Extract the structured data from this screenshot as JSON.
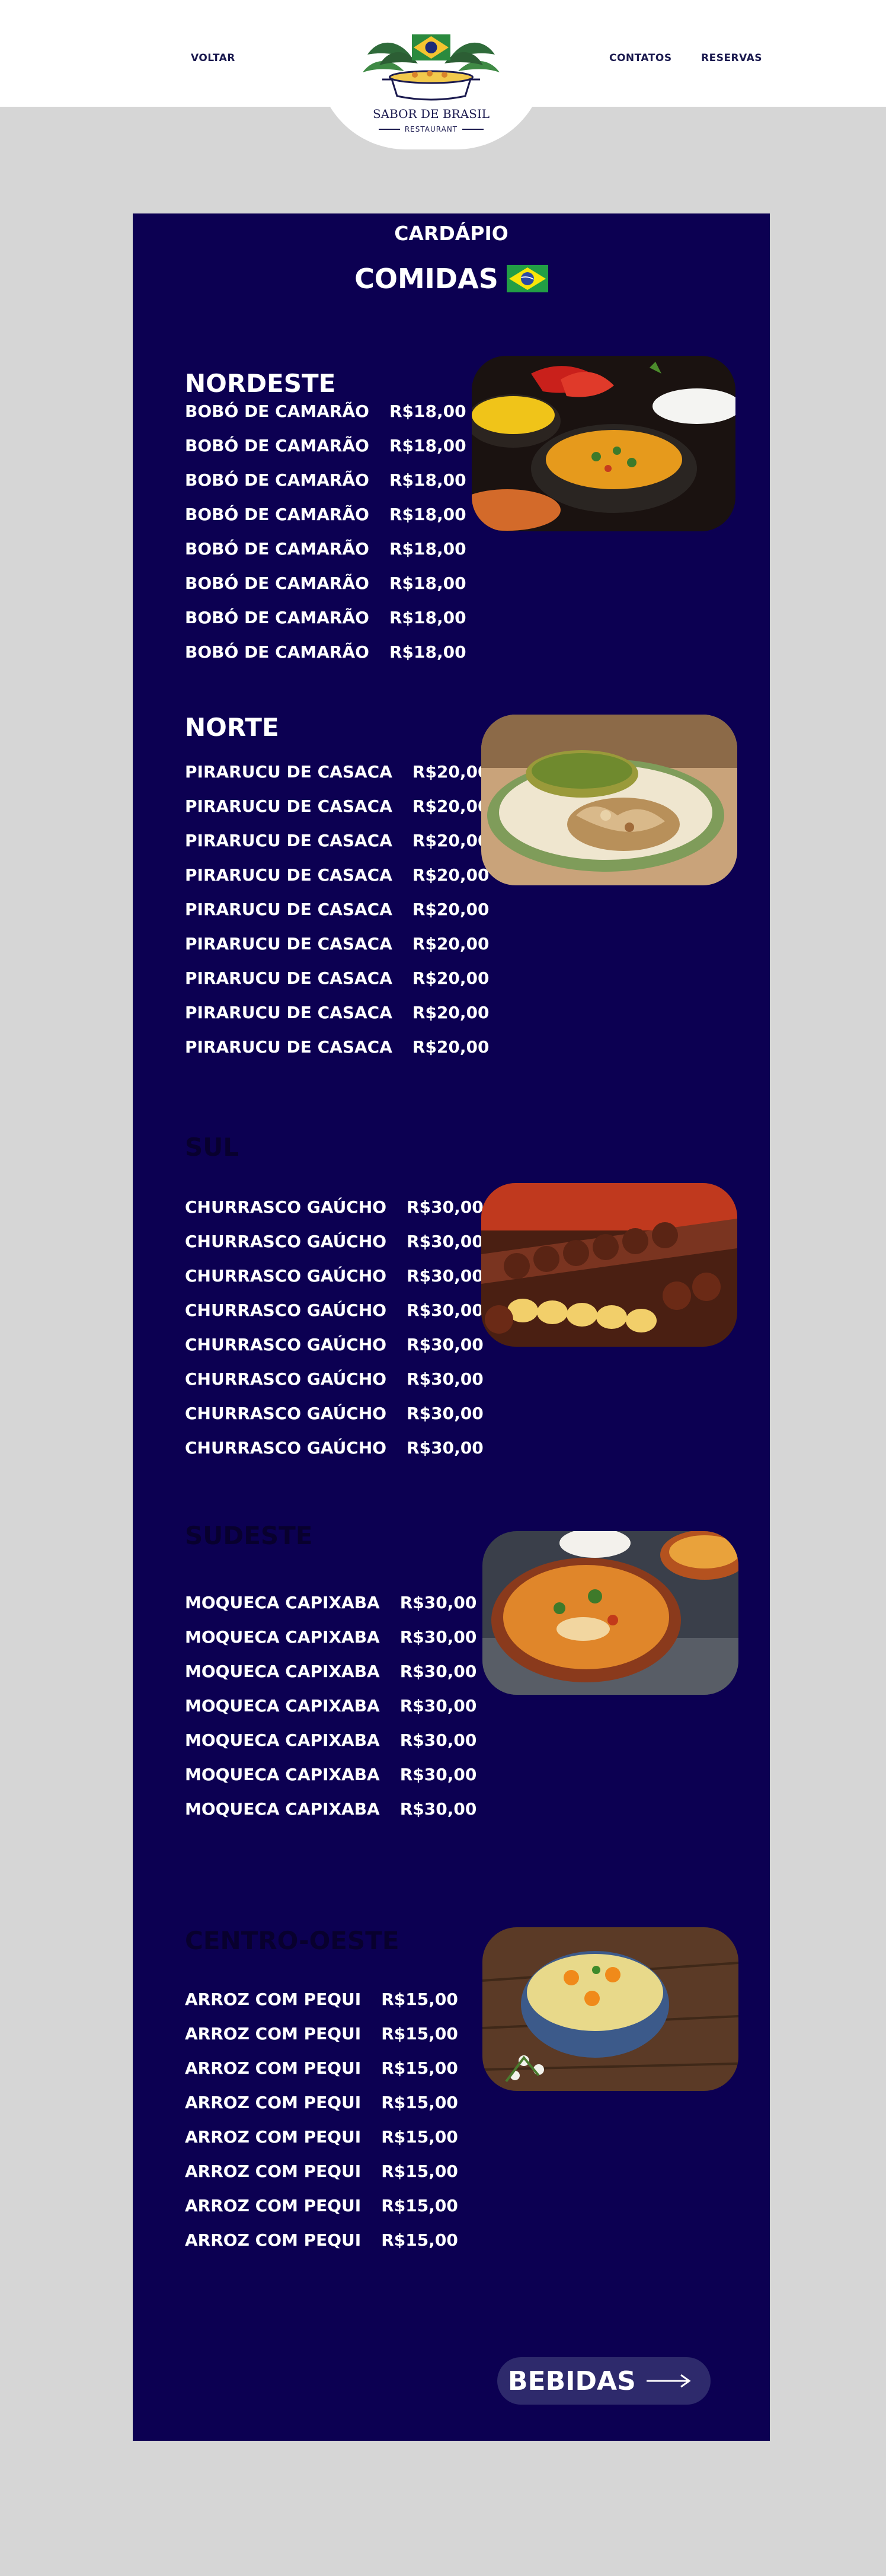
{
  "header": {
    "back_label": "VOLTAR",
    "contacts_label": "CONTATOS",
    "reservations_label": "RESERVAS",
    "logo_title": "SABOR DE BRASIL",
    "logo_subtitle": "RESTAURANT"
  },
  "menu": {
    "label": "CARDÁPIO",
    "heading": "COMIDAS",
    "sections": [
      {
        "title": "NORDESTE",
        "items": [
          {
            "name": "BOBÓ DE CAMARÃO",
            "price": "R$18,00"
          },
          {
            "name": "BOBÓ DE CAMARÃO",
            "price": "R$18,00"
          },
          {
            "name": "BOBÓ DE CAMARÃO",
            "price": "R$18,00"
          },
          {
            "name": "BOBÓ DE CAMARÃO",
            "price": "R$18,00"
          },
          {
            "name": "BOBÓ DE CAMARÃO",
            "price": "R$18,00"
          },
          {
            "name": "BOBÓ DE CAMARÃO",
            "price": "R$18,00"
          },
          {
            "name": "BOBÓ DE CAMARÃO",
            "price": "R$18,00"
          },
          {
            "name": "BOBÓ DE CAMARÃO",
            "price": "R$18,00"
          }
        ]
      },
      {
        "title": "NORTE",
        "items": [
          {
            "name": "PIRARUCU DE CASACA",
            "price": "R$20,00"
          },
          {
            "name": "PIRARUCU DE CASACA",
            "price": "R$20,00"
          },
          {
            "name": "PIRARUCU DE CASACA",
            "price": "R$20,00"
          },
          {
            "name": "PIRARUCU DE CASACA",
            "price": "R$20,00"
          },
          {
            "name": "PIRARUCU DE CASACA",
            "price": "R$20,00"
          },
          {
            "name": "PIRARUCU DE CASACA",
            "price": "R$20,00"
          },
          {
            "name": "PIRARUCU DE CASACA",
            "price": "R$20,00"
          },
          {
            "name": "PIRARUCU DE CASACA",
            "price": "R$20,00"
          },
          {
            "name": "PIRARUCU DE CASACA",
            "price": "R$20,00"
          }
        ]
      },
      {
        "title": "SUL",
        "items": [
          {
            "name": "CHURRASCO GAÚCHO",
            "price": "R$30,00"
          },
          {
            "name": "CHURRASCO GAÚCHO",
            "price": "R$30,00"
          },
          {
            "name": "CHURRASCO GAÚCHO",
            "price": "R$30,00"
          },
          {
            "name": "CHURRASCO GAÚCHO",
            "price": "R$30,00"
          },
          {
            "name": "CHURRASCO GAÚCHO",
            "price": "R$30,00"
          },
          {
            "name": "CHURRASCO GAÚCHO",
            "price": "R$30,00"
          },
          {
            "name": "CHURRASCO GAÚCHO",
            "price": "R$30,00"
          },
          {
            "name": "CHURRASCO GAÚCHO",
            "price": "R$30,00"
          }
        ]
      },
      {
        "title": "SUDESTE",
        "items": [
          {
            "name": "MOQUECA CAPIXABA",
            "price": "R$30,00"
          },
          {
            "name": "MOQUECA CAPIXABA",
            "price": "R$30,00"
          },
          {
            "name": "MOQUECA CAPIXABA",
            "price": "R$30,00"
          },
          {
            "name": "MOQUECA CAPIXABA",
            "price": "R$30,00"
          },
          {
            "name": "MOQUECA CAPIXABA",
            "price": "R$30,00"
          },
          {
            "name": "MOQUECA CAPIXABA",
            "price": "R$30,00"
          },
          {
            "name": "MOQUECA CAPIXABA",
            "price": "R$30,00"
          }
        ]
      },
      {
        "title": "CENTRO-OESTE",
        "items": [
          {
            "name": "ARROZ COM PEQUI",
            "price": "R$15,00"
          },
          {
            "name": "ARROZ COM PEQUI",
            "price": "R$15,00"
          },
          {
            "name": "ARROZ COM PEQUI",
            "price": "R$15,00"
          },
          {
            "name": "ARROZ COM PEQUI",
            "price": "R$15,00"
          },
          {
            "name": "ARROZ COM PEQUI",
            "price": "R$15,00"
          },
          {
            "name": "ARROZ COM PEQUI",
            "price": "R$15,00"
          },
          {
            "name": "ARROZ COM PEQUI",
            "price": "R$15,00"
          },
          {
            "name": "ARROZ COM PEQUI",
            "price": "R$15,00"
          }
        ]
      }
    ],
    "next_button_label": "BEBIDAS"
  },
  "colors": {
    "panel": "#0c0052",
    "page_background": "#d6d6d6",
    "header_background": "#ffffff",
    "button_background": "#2e2a6c",
    "text_light": "#ffffff",
    "text_dark": "#08002e"
  },
  "icons": [
    "brazil-flag-icon",
    "arrow-right-icon",
    "restaurant-logo-icon"
  ]
}
